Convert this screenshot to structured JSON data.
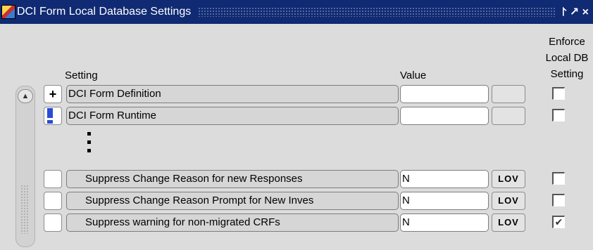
{
  "window": {
    "title": "DCI Form Local Database Settings",
    "controls": "⨡ ↗ ×"
  },
  "headers": {
    "setting": "Setting",
    "value": "Value",
    "enforce": "Enforce\nLocal DB\nSetting"
  },
  "tree_rows": [
    {
      "toggle": "+",
      "label": "DCI Form Definition",
      "value": "",
      "enforce": false
    },
    {
      "toggle": "-",
      "label": "DCI Form Runtime",
      "value": "",
      "enforce": false
    }
  ],
  "ellipsis_icon": "vertical-ellipsis",
  "setting_rows": [
    {
      "label": "Suppress Change Reason for new Responses",
      "value": "N",
      "lov": "LOV",
      "enforce": false
    },
    {
      "label": "Suppress Change Reason Prompt for New Inves",
      "value": "N",
      "lov": "LOV",
      "enforce": false
    },
    {
      "label": "Suppress warning for non-migrated CRFs",
      "value": "N",
      "lov": "LOV",
      "enforce": true
    }
  ],
  "checkmark_glyph": "✔",
  "colors": {
    "titlebar": "#102a73",
    "background": "#dcdcdc",
    "selected_toggle": "#2a4bd4"
  }
}
